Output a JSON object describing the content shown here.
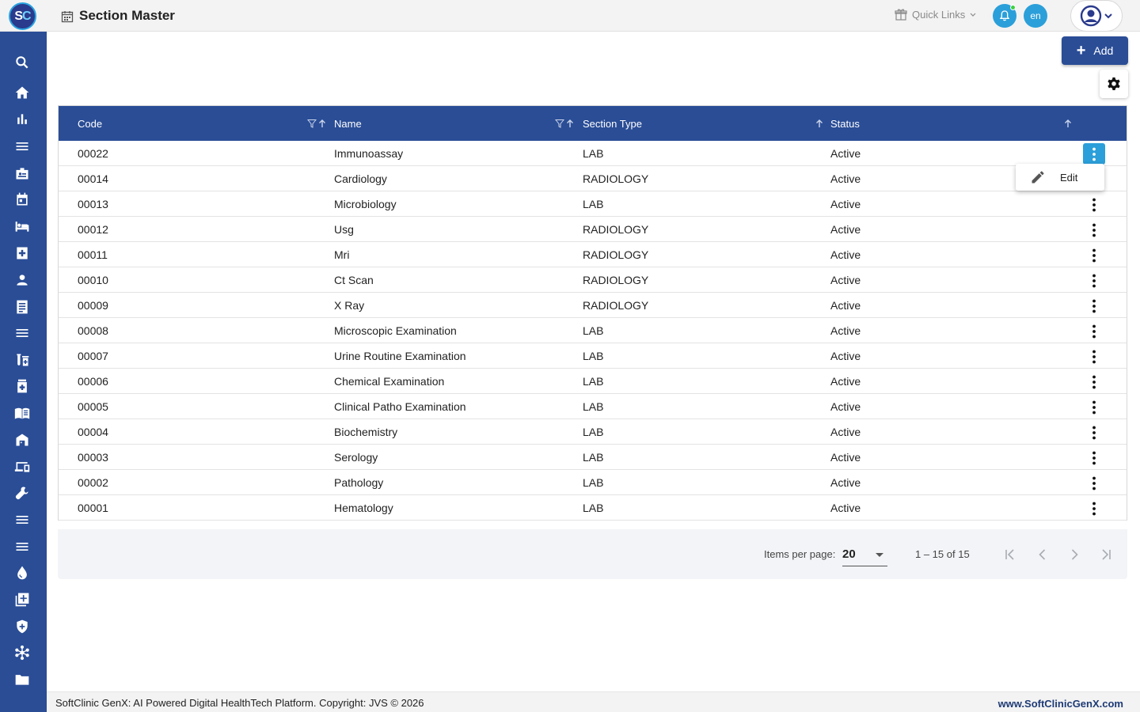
{
  "app": {
    "logo_text": "S",
    "logo_text_c": "C",
    "page_title": "Section Master"
  },
  "topbar": {
    "quick_links": "Quick Links",
    "lang": "en"
  },
  "actions": {
    "add_label": "Add"
  },
  "table": {
    "headers": [
      "Code",
      "Name",
      "Section Type",
      "Status"
    ],
    "rows": [
      {
        "code": "00022",
        "name": "Immunoassay",
        "type": "LAB",
        "status": "Active"
      },
      {
        "code": "00014",
        "name": "Cardiology",
        "type": "RADIOLOGY",
        "status": "Active"
      },
      {
        "code": "00013",
        "name": "Microbiology",
        "type": "LAB",
        "status": "Active"
      },
      {
        "code": "00012",
        "name": "Usg",
        "type": "RADIOLOGY",
        "status": "Active"
      },
      {
        "code": "00011",
        "name": "Mri",
        "type": "RADIOLOGY",
        "status": "Active"
      },
      {
        "code": "00010",
        "name": "Ct Scan",
        "type": "RADIOLOGY",
        "status": "Active"
      },
      {
        "code": "00009",
        "name": "X Ray",
        "type": "RADIOLOGY",
        "status": "Active"
      },
      {
        "code": "00008",
        "name": "Microscopic Examination",
        "type": "LAB",
        "status": "Active"
      },
      {
        "code": "00007",
        "name": "Urine Routine Examination",
        "type": "LAB",
        "status": "Active"
      },
      {
        "code": "00006",
        "name": "Chemical Examination",
        "type": "LAB",
        "status": "Active"
      },
      {
        "code": "00005",
        "name": "Clinical Patho Examination",
        "type": "LAB",
        "status": "Active"
      },
      {
        "code": "00004",
        "name": "Biochemistry",
        "type": "LAB",
        "status": "Active"
      },
      {
        "code": "00003",
        "name": "Serology",
        "type": "LAB",
        "status": "Active"
      },
      {
        "code": "00002",
        "name": "Pathology",
        "type": "LAB",
        "status": "Active"
      },
      {
        "code": "00001",
        "name": "Hematology",
        "type": "LAB",
        "status": "Active"
      }
    ]
  },
  "row_menu": {
    "edit_label": "Edit"
  },
  "paginator": {
    "items_per_page_label": "Items per page:",
    "items_per_page": "20",
    "range": "1 – 15 of 15"
  },
  "footer": {
    "copyright": "SoftClinic GenX: AI Powered Digital HealthTech Platform. Copyright: JVS © 2026",
    "website": "www.SoftClinicGenX.com"
  },
  "colors": {
    "primary": "#2a4d96",
    "accent": "#2b9fd9",
    "notification_dot": "#3ad13a"
  },
  "sidebar_icons": [
    "search-icon",
    "home-icon",
    "bar-chart-icon",
    "menu-icon",
    "badge-icon",
    "calendar-icon",
    "bed-icon",
    "medical-plus-icon",
    "person-icon",
    "receipt-icon",
    "menu-icon",
    "lab-tubes-icon",
    "medication-icon",
    "book-icon",
    "store-icon",
    "devices-icon",
    "wrench-icon",
    "menu-icon",
    "menu-icon",
    "drop-icon",
    "add-box-icon",
    "shield-icon",
    "hub-icon",
    "folder-icon"
  ]
}
